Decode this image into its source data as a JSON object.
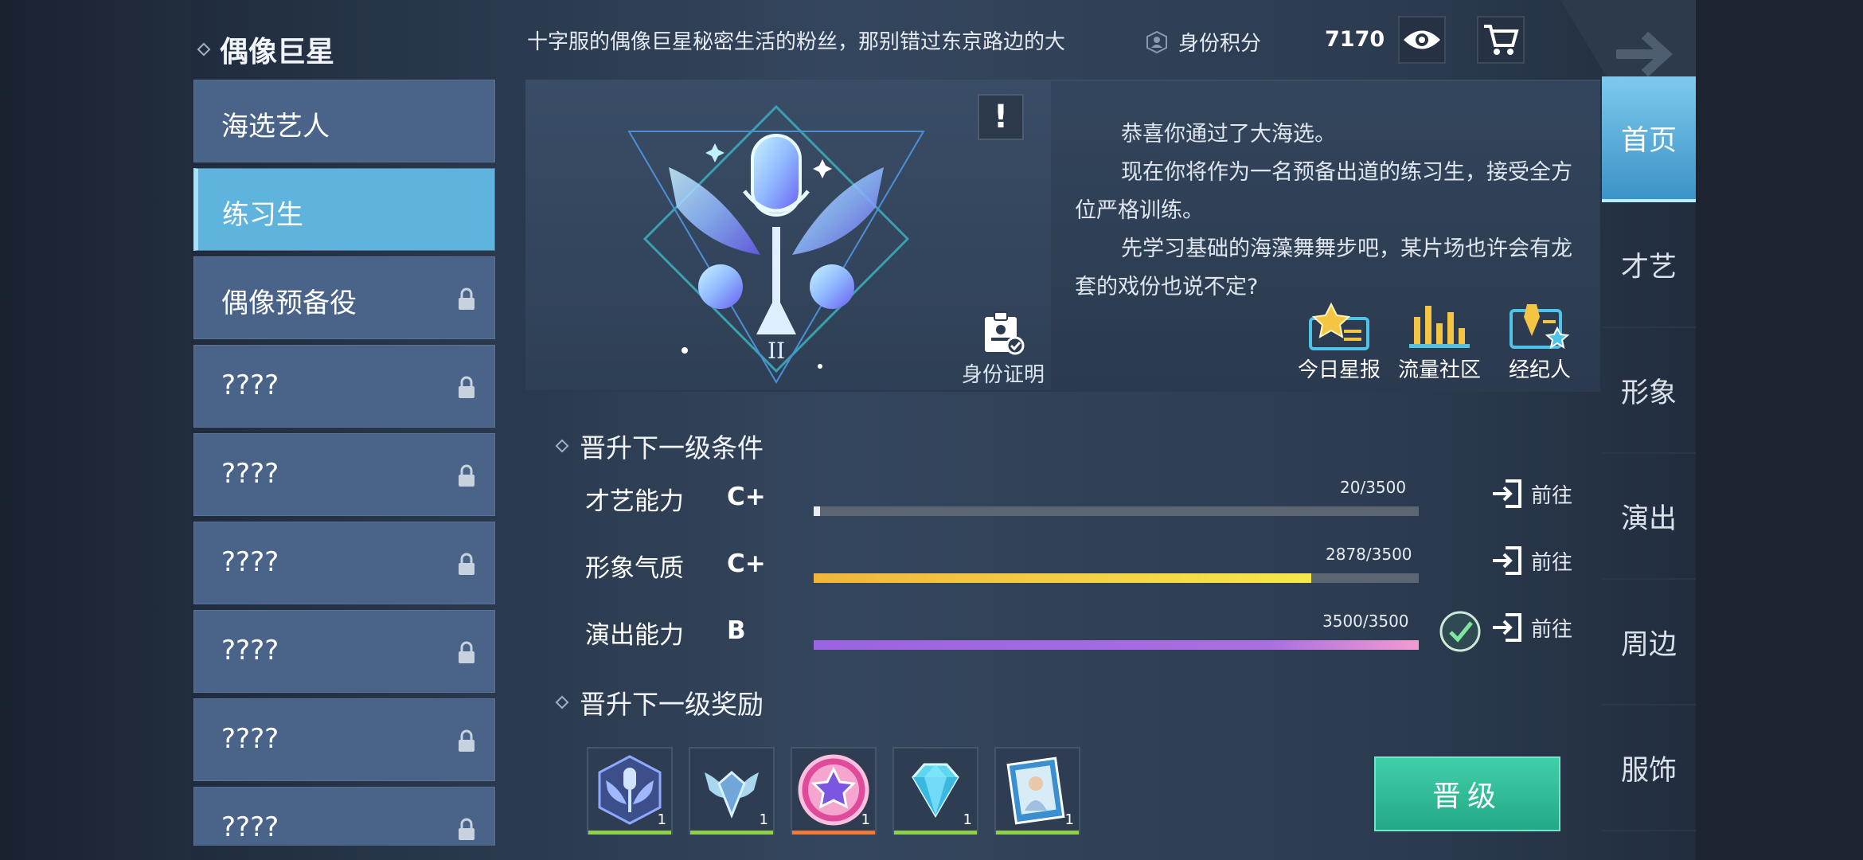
{
  "header": {
    "title": "偶像巨星",
    "marquee": "十字服的偶像巨星秘密生活的粉丝，那别错过东京路边的大",
    "points_label": "身份积分",
    "points_value": "7170"
  },
  "sidebar": {
    "items": [
      {
        "label": "海选艺人",
        "locked": false,
        "active": false
      },
      {
        "label": "练习生",
        "locked": false,
        "active": true
      },
      {
        "label": "偶像预备役",
        "locked": true,
        "active": false
      },
      {
        "label": "????",
        "locked": true,
        "active": false
      },
      {
        "label": "????",
        "locked": true,
        "active": false
      },
      {
        "label": "????",
        "locked": true,
        "active": false
      },
      {
        "label": "????",
        "locked": true,
        "active": false
      },
      {
        "label": "????",
        "locked": true,
        "active": false
      },
      {
        "label": "????",
        "locked": true,
        "active": false
      }
    ]
  },
  "card": {
    "alert_glyph": "!",
    "id_proof_label": "身份证明",
    "description": [
      "恭喜你通过了大海选。",
      "现在你将作为一名预备出道的练习生，接受全方位严格训练。",
      "先学习基础的海藻舞舞步吧，某片场也许会有龙套的戏份也说不定?"
    ],
    "quick_links": [
      {
        "label": "今日星报",
        "icon": "star-news-icon"
      },
      {
        "label": "流量社区",
        "icon": "chart-community-icon"
      },
      {
        "label": "经纪人",
        "icon": "agent-icon"
      }
    ]
  },
  "requirements": {
    "title": "晋升下一级条件",
    "goto_label": "前往",
    "stats": [
      {
        "name": "才艺能力",
        "grade": "C+",
        "current": 20,
        "max": 3500,
        "value_text": "20/3500",
        "color": "#e9edf1",
        "complete": false
      },
      {
        "name": "形象气质",
        "grade": "C+",
        "current": 2878,
        "max": 3500,
        "value_text": "2878/3500",
        "color": "#f4c542",
        "complete": false
      },
      {
        "name": "演出能力",
        "grade": "B",
        "current": 3500,
        "max": 3500,
        "value_text": "3500/3500",
        "color": "#a56de0",
        "complete": true
      }
    ]
  },
  "rewards": {
    "title": "晋升下一级奖励",
    "items": [
      {
        "icon": "emblem-icon",
        "count": "1",
        "rarity_color": "#8fd14a"
      },
      {
        "icon": "wings-badge-icon",
        "count": "1",
        "rarity_color": "#8fd14a"
      },
      {
        "icon": "star-medal-icon",
        "count": "1",
        "rarity_color": "#f07a3a"
      },
      {
        "icon": "diamond-icon",
        "count": "1",
        "rarity_color": "#8fd14a"
      },
      {
        "icon": "poster-icon",
        "count": "1",
        "rarity_color": "#8fd14a"
      }
    ],
    "upgrade_label": "晋级"
  },
  "right_nav": {
    "tabs": [
      {
        "label": "首页",
        "active": true
      },
      {
        "label": "才艺",
        "active": false
      },
      {
        "label": "形象",
        "active": false
      },
      {
        "label": "演出",
        "active": false
      },
      {
        "label": "周边",
        "active": false
      },
      {
        "label": "服饰",
        "active": false
      }
    ]
  }
}
